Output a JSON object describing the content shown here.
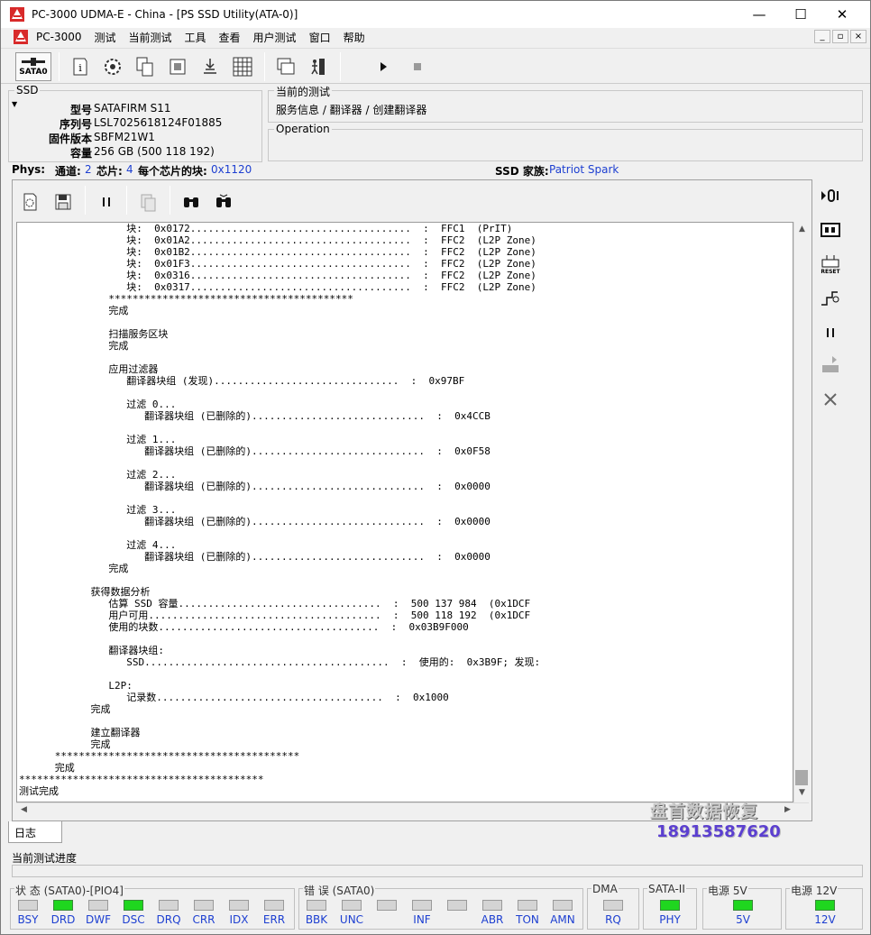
{
  "window": {
    "title": "PC-3000 UDMA-E - China - [PS SSD Utility(ATA-0)]",
    "min": "—",
    "max": "☐",
    "close": "✕"
  },
  "menu": {
    "items": [
      "PC-3000",
      "测试",
      "当前测试",
      "工具",
      "查看",
      "用户测试",
      "窗口",
      "帮助"
    ]
  },
  "toolbar": {
    "port_label": "SATA0"
  },
  "ssd": {
    "group_title": "SSD",
    "rows": [
      {
        "k": "型号",
        "v": "SATAFIRM   S11"
      },
      {
        "k": "序列号",
        "v": "LSL7025618124F01885"
      },
      {
        "k": "固件版本",
        "v": "SBFM21W1"
      },
      {
        "k": "容量",
        "v": "256 GB (500 118 192)"
      }
    ]
  },
  "current_test": {
    "title": "当前的测试",
    "path": "服务信息 / 翻译器 / 创建翻译器"
  },
  "operation": {
    "title": "Operation"
  },
  "phys": {
    "label": "Phys:",
    "channels_label": "通道:",
    "channels": "2",
    "chips_label": "芯片:",
    "chips": "4",
    "blocks_label": "每个芯片的块:",
    "blocks": "0x1120",
    "family_label": "SSD 家族:",
    "family": "Patriot Spark"
  },
  "log": {
    "text": "                  块:  0x0172.....................................  :  FFC1  (PrIT)\n                  块:  0x01A2.....................................  :  FFC2  (L2P Zone)\n                  块:  0x01B2.....................................  :  FFC2  (L2P Zone)\n                  块:  0x01F3.....................................  :  FFC2  (L2P Zone)\n                  块:  0x0316.....................................  :  FFC2  (L2P Zone)\n                  块:  0x0317.....................................  :  FFC2  (L2P Zone)\n               *****************************************\n               完成\n\n               扫描服务区块\n               完成\n\n               应用过滤器\n                  翻译器块组 (发现)...............................  :  0x97BF\n\n                  过滤 0...\n                     翻译器块组 (已删除的).............................  :  0x4CCB\n\n                  过滤 1...\n                     翻译器块组 (已删除的).............................  :  0x0F58\n\n                  过滤 2...\n                     翻译器块组 (已删除的).............................  :  0x0000\n\n                  过滤 3...\n                     翻译器块组 (已删除的).............................  :  0x0000\n\n                  过滤 4...\n                     翻译器块组 (已删除的).............................  :  0x0000\n               完成\n\n            获得数据分析\n               估算 SSD 容量..................................  :  500 137 984  (0x1DCF\n               用户可用.......................................  :  500 118 192  (0x1DCF\n               使用的块数.....................................  :  0x03B9F000\n\n               翻译器块组:\n                  SSD.........................................  :  使用的:  0x3B9F; 发现:\n\n               L2P:\n                  记录数......................................  :  0x1000\n            完成\n\n            建立翻译器\n            完成\n      *****************************************\n      完成\n*****************************************\n测试完成"
  },
  "tab": {
    "label": "日志"
  },
  "progress": {
    "label": "当前测试进度",
    "value": 0
  },
  "status_groups": [
    {
      "title": "状 态 (SATA0)-[PIO4]",
      "leds": [
        {
          "label": "BSY",
          "on": false
        },
        {
          "label": "DRD",
          "on": true
        },
        {
          "label": "DWF",
          "on": false
        },
        {
          "label": "DSC",
          "on": true
        },
        {
          "label": "DRQ",
          "on": false
        },
        {
          "label": "CRR",
          "on": false
        },
        {
          "label": "IDX",
          "on": false
        },
        {
          "label": "ERR",
          "on": false
        }
      ]
    },
    {
      "title": "错 误 (SATA0)",
      "leds": [
        {
          "label": "BBK",
          "on": false
        },
        {
          "label": "UNC",
          "on": false
        },
        {
          "label": "",
          "on": false
        },
        {
          "label": "INF",
          "on": false
        },
        {
          "label": "",
          "on": false
        },
        {
          "label": "ABR",
          "on": false
        },
        {
          "label": "TON",
          "on": false
        },
        {
          "label": "AMN",
          "on": false
        }
      ]
    },
    {
      "title": "DMA",
      "leds": [
        {
          "label": "RQ",
          "on": false
        }
      ]
    },
    {
      "title": "SATA-II",
      "leds": [
        {
          "label": "PHY",
          "on": true
        }
      ]
    },
    {
      "title": "电源 5V",
      "leds": [
        {
          "label": "5V",
          "on": true
        }
      ]
    },
    {
      "title": "电源 12V",
      "leds": [
        {
          "label": "12V",
          "on": true
        }
      ]
    }
  ],
  "watermark": {
    "line1": "盘首数据恢复",
    "line2": "18913587620"
  },
  "colors": {
    "led_on": "#1fd61f",
    "led_off": "#d4d4d4",
    "label_blue": "#1d3fd1"
  }
}
